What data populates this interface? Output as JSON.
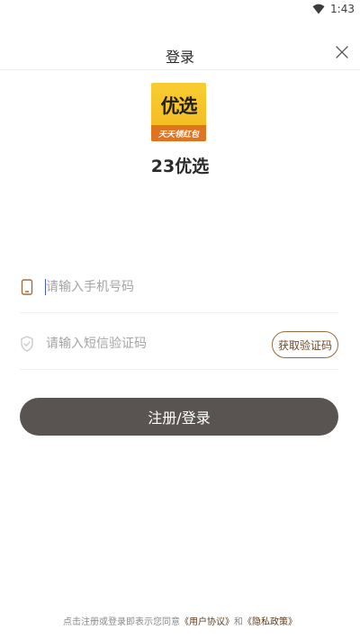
{
  "status": {
    "time": "1:43",
    "wifi_icon": "wifi-icon"
  },
  "nav": {
    "title": "登录",
    "close_icon": "close-icon"
  },
  "brand": {
    "logo_text": "优选",
    "logo_band_text": "天天领红包",
    "app_name": "23优选",
    "colors": {
      "logo_bg": "#f6c32a",
      "logo_band": "#e0731f"
    }
  },
  "form": {
    "phone": {
      "placeholder": "请输入手机号码",
      "value": "",
      "icon": "phone-icon"
    },
    "code": {
      "placeholder": "请输入短信验证码",
      "value": "",
      "icon": "shield-check-icon"
    },
    "get_code_label": "获取验证码",
    "submit_label": "注册/登录"
  },
  "agreement": {
    "prefix": "点击注册或登录即表示您同意",
    "user_agreement": "《用户协议》",
    "and": "和",
    "privacy_policy": "《隐私政策》"
  },
  "colors": {
    "accent": "#6e4a27",
    "button_bg": "#595451"
  }
}
